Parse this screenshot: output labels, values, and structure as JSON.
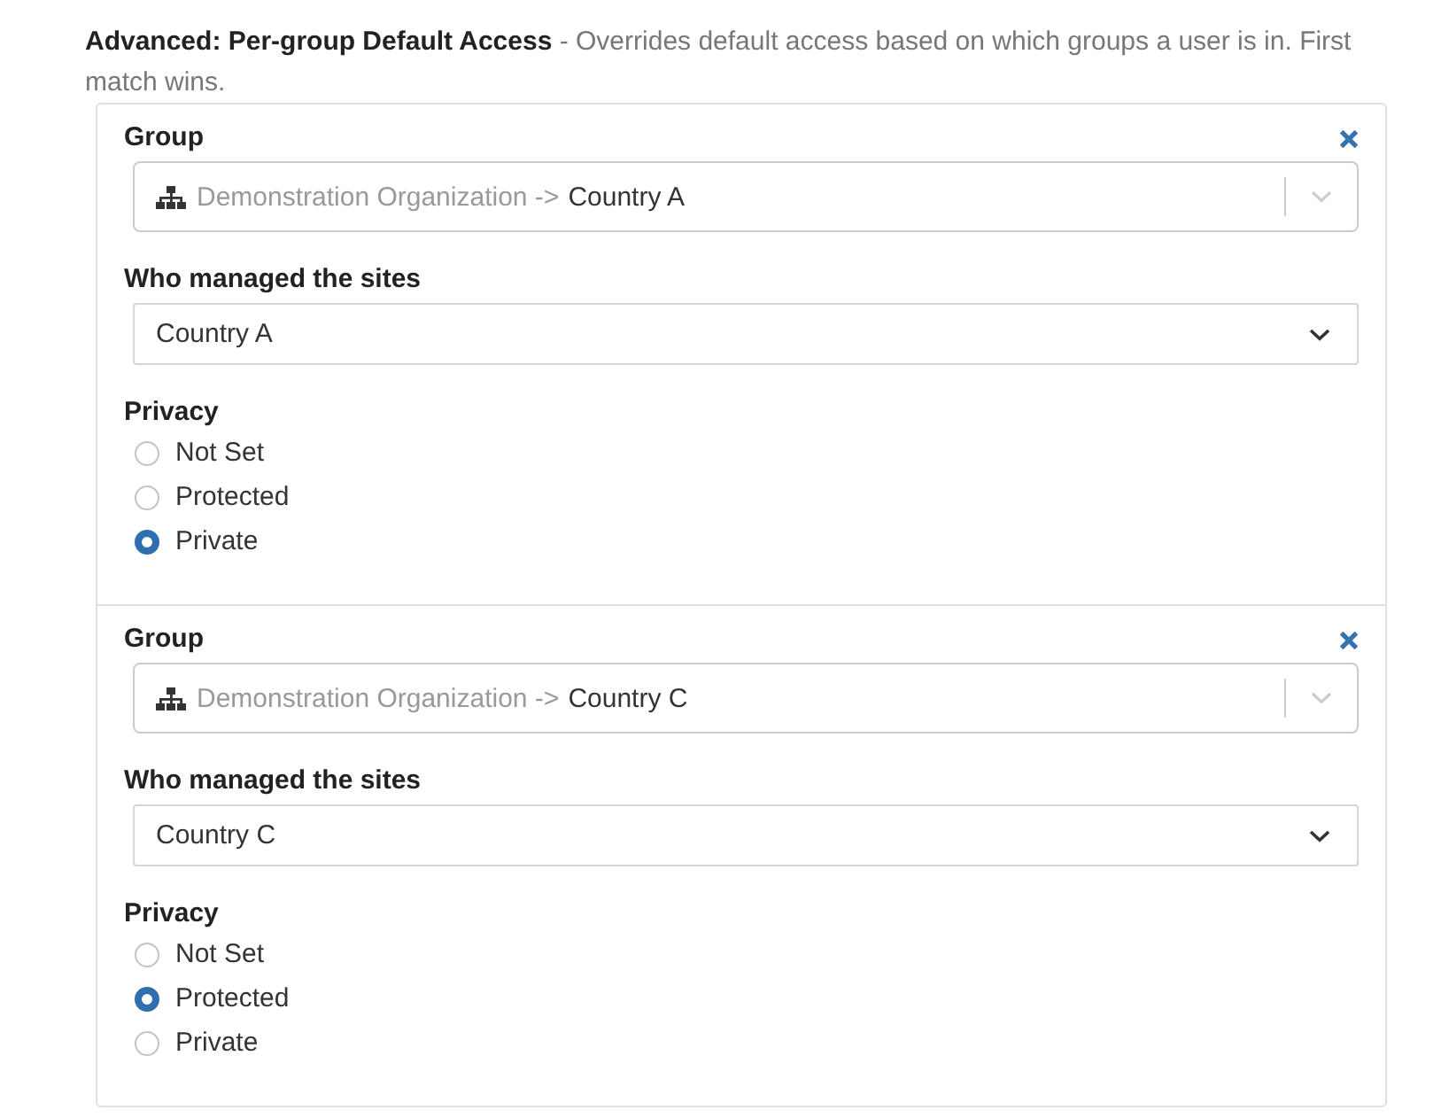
{
  "intro": "**Advanced: Per-group Default Access** - Overrides default access based on which groups a user is in. First match wins.",
  "rules": [
    {
      "group": {
        "label": "Group",
        "path": "Demonstration Organization ->",
        "value": "Country A"
      },
      "manager": {
        "label": "Who managed the sites",
        "value": "Country A"
      },
      "privacy": {
        "label": "Privacy",
        "options": [
          {
            "label": "Not Set",
            "selected": false
          },
          {
            "label": "Protected",
            "selected": false
          },
          {
            "label": "Private",
            "selected": true
          }
        ]
      }
    },
    {
      "group": {
        "label": "Group",
        "path": "Demonstration Organization ->",
        "value": "Country C"
      },
      "manager": {
        "label": "Who managed the sites",
        "value": "Country C"
      },
      "privacy": {
        "label": "Privacy",
        "options": [
          {
            "label": "Not Set",
            "selected": false
          },
          {
            "label": "Protected",
            "selected": true
          },
          {
            "label": "Private",
            "selected": false
          }
        ]
      }
    }
  ]
}
